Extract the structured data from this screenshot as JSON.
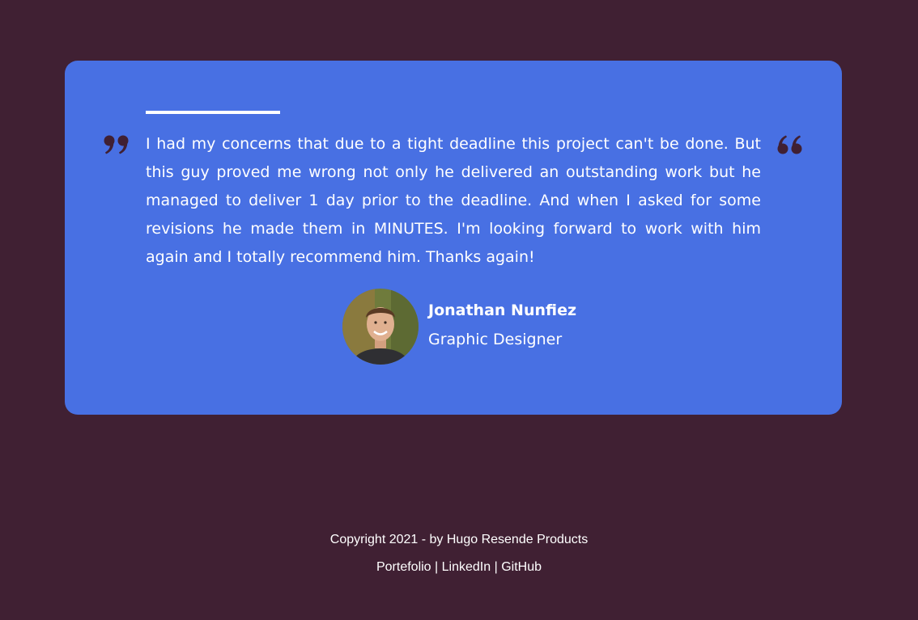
{
  "testimonial": {
    "quote": "I had my concerns that due to a tight deadline this project can't be done. But this guy proved me wrong not only he delivered an outstanding work but he managed to deliver 1 day prior to the deadline. And when I asked for some revisions he made them in MINUTES. I'm looking forward to work with him again and I totally recommend him. Thanks again!",
    "author_name": "Jonathan Nunfiez",
    "author_role": "Graphic Designer"
  },
  "footer": {
    "copyright": "Copyright 2021 - by Hugo Resende Products",
    "links": [
      "Portefolio",
      "LinkedIn",
      "GitHub"
    ],
    "separator": "|"
  },
  "colors": {
    "page_background": "#402033",
    "card_background": "#4870e3",
    "quote_mark": "#402033",
    "text": "#ffffff"
  },
  "icons": {
    "left_quote": "closing-quote-icon",
    "right_quote": "opening-quote-icon"
  }
}
